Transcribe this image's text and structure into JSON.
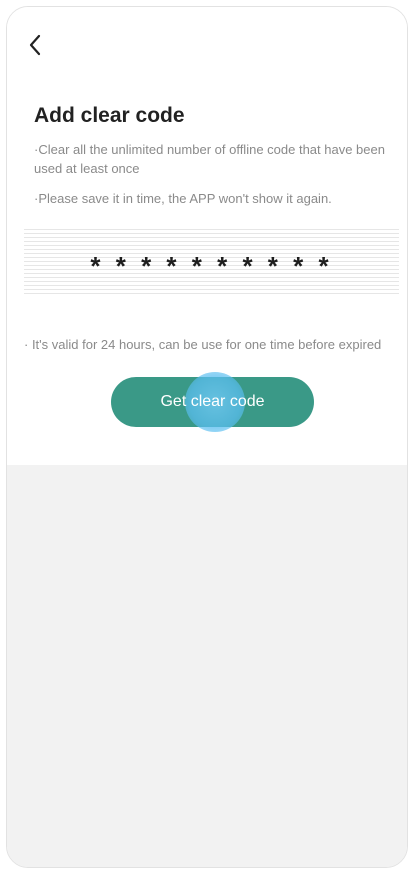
{
  "header": {
    "back_icon": "chevron-left-icon"
  },
  "page": {
    "title": "Add clear code",
    "description_1": "·Clear all the unlimited number of  offline code that have been used at least once",
    "description_2": "·Please save it in time, the APP won't show it again."
  },
  "code": {
    "value": "**********"
  },
  "validity_note": "· It's valid for 24 hours, can be use for one time before expired",
  "actions": {
    "get_code_label": "Get clear code"
  },
  "colors": {
    "accent": "#3a9987",
    "ripple": "#5bbef0",
    "muted_text": "#8a8a8a",
    "lower_background": "#f2f2f2"
  }
}
